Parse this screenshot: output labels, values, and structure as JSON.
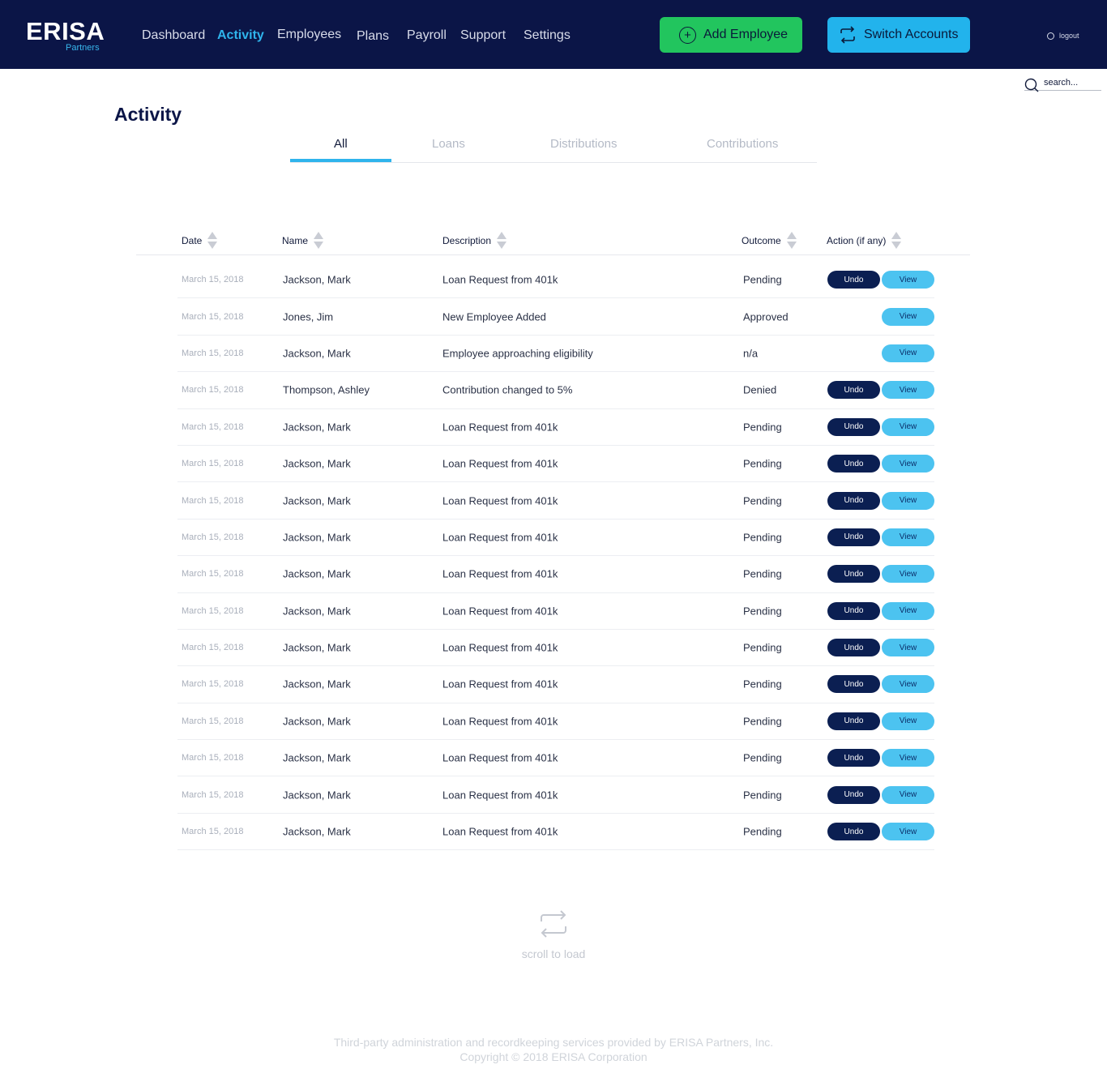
{
  "brand": {
    "name": "ERISA",
    "sub": "Partners"
  },
  "nav": [
    {
      "label": "Dashboard",
      "active": false
    },
    {
      "label": "Activity",
      "active": true
    },
    {
      "label": "Employees",
      "active": false
    },
    {
      "label": "Plans",
      "active": false
    },
    {
      "label": "Payroll",
      "active": false
    },
    {
      "label": "Support",
      "active": false
    },
    {
      "label": "Settings",
      "active": false
    }
  ],
  "header": {
    "add_employee": "Add Employee",
    "switch_accounts": "Switch Accounts",
    "logout": "logout"
  },
  "search": {
    "placeholder": "search..."
  },
  "page": {
    "title": "Activity"
  },
  "tabs": [
    {
      "label": "All",
      "active": true
    },
    {
      "label": "Loans",
      "active": false
    },
    {
      "label": "Distributions",
      "active": false
    },
    {
      "label": "Contributions",
      "active": false
    }
  ],
  "table": {
    "columns": [
      "Date",
      "Name",
      "Description",
      "Outcome",
      "Action (if any)"
    ],
    "rows": [
      {
        "date": "March 15, 2018",
        "name": "Jackson, Mark",
        "description": "Loan Request from 401k",
        "outcome": "Pending",
        "undo": "Undo",
        "view": "View"
      },
      {
        "date": "March 15, 2018",
        "name": "Jones, Jim",
        "description": "New Employee Added",
        "outcome": "Approved",
        "undo": null,
        "view": "View"
      },
      {
        "date": "March 15, 2018",
        "name": "Jackson, Mark",
        "description": "Employee approaching eligibility",
        "outcome": "n/a",
        "undo": null,
        "view": "View"
      },
      {
        "date": "March 15, 2018",
        "name": "Thompson, Ashley",
        "description": "Contribution changed to 5%",
        "outcome": "Denied",
        "undo": "Undo",
        "view": "View"
      },
      {
        "date": "March 15, 2018",
        "name": "Jackson, Mark",
        "description": "Loan Request from 401k",
        "outcome": "Pending",
        "undo": "Undo",
        "view": "View"
      },
      {
        "date": "March 15, 2018",
        "name": "Jackson, Mark",
        "description": "Loan Request from 401k",
        "outcome": "Pending",
        "undo": "Undo",
        "view": "View"
      },
      {
        "date": "March 15, 2018",
        "name": "Jackson, Mark",
        "description": "Loan Request from 401k",
        "outcome": "Pending",
        "undo": "Undo",
        "view": "View"
      },
      {
        "date": "March 15, 2018",
        "name": "Jackson, Mark",
        "description": "Loan Request from 401k",
        "outcome": "Pending",
        "undo": "Undo",
        "view": "View"
      },
      {
        "date": "March 15, 2018",
        "name": "Jackson, Mark",
        "description": "Loan Request from 401k",
        "outcome": "Pending",
        "undo": "Undo",
        "view": "View"
      },
      {
        "date": "March 15, 2018",
        "name": "Jackson, Mark",
        "description": "Loan Request from 401k",
        "outcome": "Pending",
        "undo": "Undo",
        "view": "View"
      },
      {
        "date": "March 15, 2018",
        "name": "Jackson, Mark",
        "description": "Loan Request from 401k",
        "outcome": "Pending",
        "undo": "Undo",
        "view": "View"
      },
      {
        "date": "March 15, 2018",
        "name": "Jackson, Mark",
        "description": "Loan Request from 401k",
        "outcome": "Pending",
        "undo": "Undo",
        "view": "View"
      },
      {
        "date": "March 15, 2018",
        "name": "Jackson, Mark",
        "description": "Loan Request from 401k",
        "outcome": "Pending",
        "undo": "Undo",
        "view": "View"
      },
      {
        "date": "March 15, 2018",
        "name": "Jackson, Mark",
        "description": "Loan Request from 401k",
        "outcome": "Pending",
        "undo": "Undo",
        "view": "View"
      },
      {
        "date": "March 15, 2018",
        "name": "Jackson, Mark",
        "description": "Loan Request from 401k",
        "outcome": "Pending",
        "undo": "Undo",
        "view": "View"
      },
      {
        "date": "March 15, 2018",
        "name": "Jackson, Mark",
        "description": "Loan Request from 401k",
        "outcome": "Pending",
        "undo": "Undo",
        "view": "View"
      }
    ]
  },
  "loader": {
    "label": "scroll to load",
    "icon": "repeat-icon"
  },
  "footer": {
    "line1": "Third-party administration and recordkeeping services provided by ERISA Partners, Inc.",
    "line2": "Copyright © 2018 ERISA Corporation"
  },
  "colors": {
    "header_bg": "#0b1547",
    "accent": "#2fb4ec",
    "add_button": "#22c55e",
    "switch_button": "#22b3ec",
    "undo_button": "#0b1f52",
    "view_button": "#4cc3f0"
  }
}
